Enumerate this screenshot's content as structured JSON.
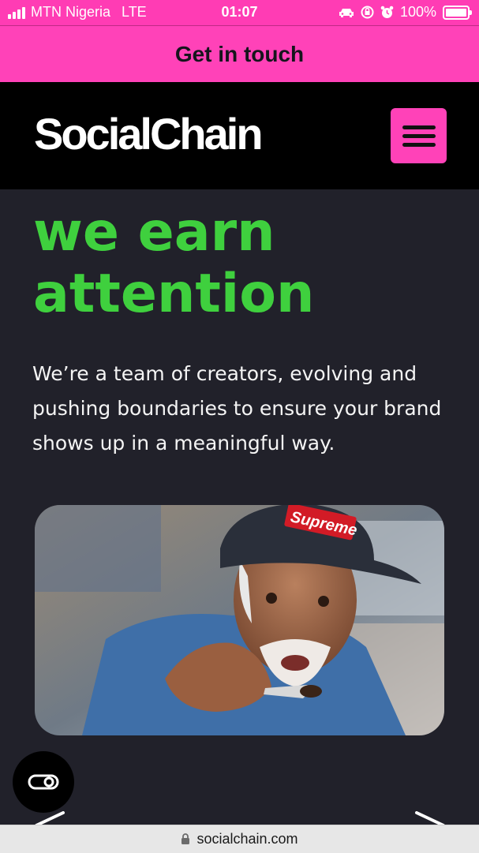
{
  "status_bar": {
    "carrier": "MTN Nigeria",
    "network": "LTE",
    "time": "01:07",
    "battery": "100%"
  },
  "cta": {
    "label": "Get in touch"
  },
  "nav": {
    "logo_text": "SocialChain",
    "menu_icon": "hamburger-icon"
  },
  "hero": {
    "headline_line1": "we earn",
    "headline_line2": "attention",
    "intro": "We’re a team of creators, evolving and pushing boundaries to ensure your brand shows up in a meaningful way.",
    "image_cap_text": "Supreme"
  },
  "controls": {
    "cookie_icon": "cookie-settings-icon",
    "prev_icon": "chevron-left-icon",
    "next_icon": "chevron-right-icon"
  },
  "browser": {
    "url": "socialchain.com"
  },
  "colors": {
    "accent_pink": "#ff42b8",
    "headline_green": "#3fd03e",
    "background": "#21212a",
    "nav_black": "#000000"
  }
}
